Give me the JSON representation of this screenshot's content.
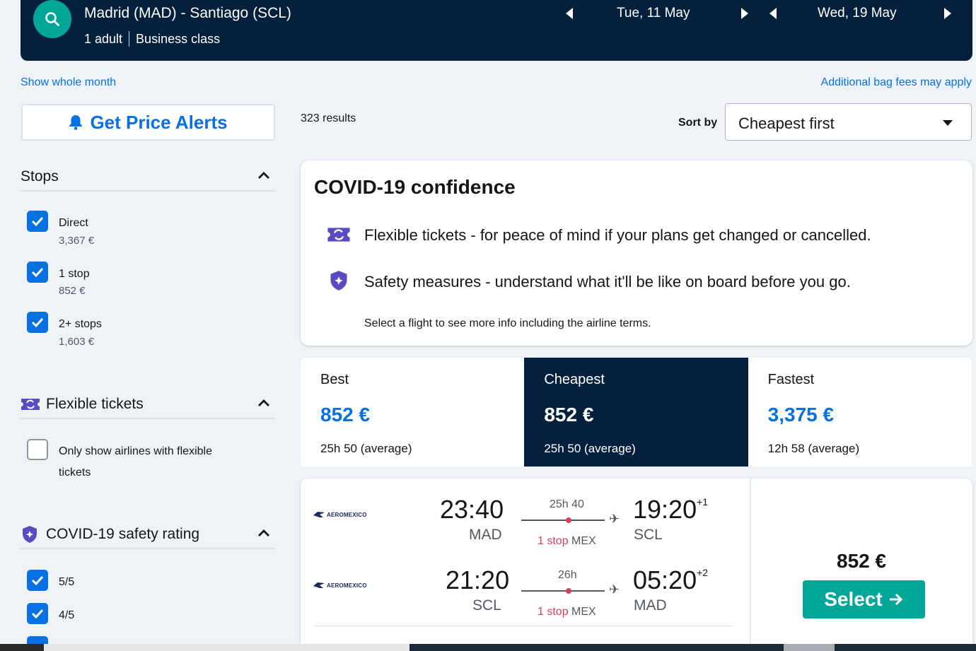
{
  "search": {
    "route": "Madrid (MAD) - Santiago (SCL)",
    "passengers": "1 adult",
    "cabin": "Business class",
    "depart_date": "Tue, 11 May",
    "return_date": "Wed, 19 May"
  },
  "links": {
    "show_whole_month": "Show whole month",
    "bag_fees": "Additional bag fees may apply"
  },
  "sidebar": {
    "price_alerts": "Get Price Alerts",
    "stops": {
      "title": "Stops",
      "options": [
        {
          "label": "Direct",
          "price": "3,367 €",
          "checked": true
        },
        {
          "label": "1 stop",
          "price": "852 €",
          "checked": true
        },
        {
          "label": "2+ stops",
          "price": "1,603 €",
          "checked": true
        }
      ]
    },
    "flexible": {
      "title": "Flexible tickets",
      "option_line1": "Only show airlines with flexible",
      "option_line2": "tickets",
      "checked": false
    },
    "covid_rating": {
      "title": "COVID-19 safety rating",
      "options": [
        {
          "label": "5/5",
          "checked": true
        },
        {
          "label": "4/5",
          "checked": true
        }
      ]
    }
  },
  "results": {
    "count": "323 results",
    "sort_label": "Sort by",
    "sort_value": "Cheapest first"
  },
  "covid": {
    "title": "COVID-19 confidence",
    "flexible": "Flexible tickets - for peace of mind if your plans get changed or cancelled.",
    "safety": "Safety measures - understand what it'll be like on board before you go.",
    "note": "Select a flight to see more info including the airline terms."
  },
  "tabs": [
    {
      "name": "Best",
      "price": "852 €",
      "duration": "25h 50 (average)"
    },
    {
      "name": "Cheapest",
      "price": "852 €",
      "duration": "25h 50 (average)"
    },
    {
      "name": "Fastest",
      "price": "3,375 €",
      "duration": "12h 58 (average)"
    }
  ],
  "flight": {
    "airline": "AEROMEXICO",
    "legs": [
      {
        "dep_time": "23:40",
        "dep_code": "MAD",
        "duration": "25h 40",
        "stops": "1 stop",
        "via": "MEX",
        "arr_time": "19:20",
        "arr_offset": "+1",
        "arr_code": "SCL"
      },
      {
        "dep_time": "21:20",
        "dep_code": "SCL",
        "duration": "26h",
        "stops": "1 stop",
        "via": "MEX",
        "arr_time": "05:20",
        "arr_offset": "+2",
        "arr_code": "MAD"
      }
    ],
    "price": "852 €",
    "select_label": "Select"
  },
  "colors": {
    "navy": "#05203c",
    "teal": "#00a698",
    "blue": "#0770e3",
    "stop_red": "#d1435b",
    "covid_purple": "#5a4cc0"
  }
}
